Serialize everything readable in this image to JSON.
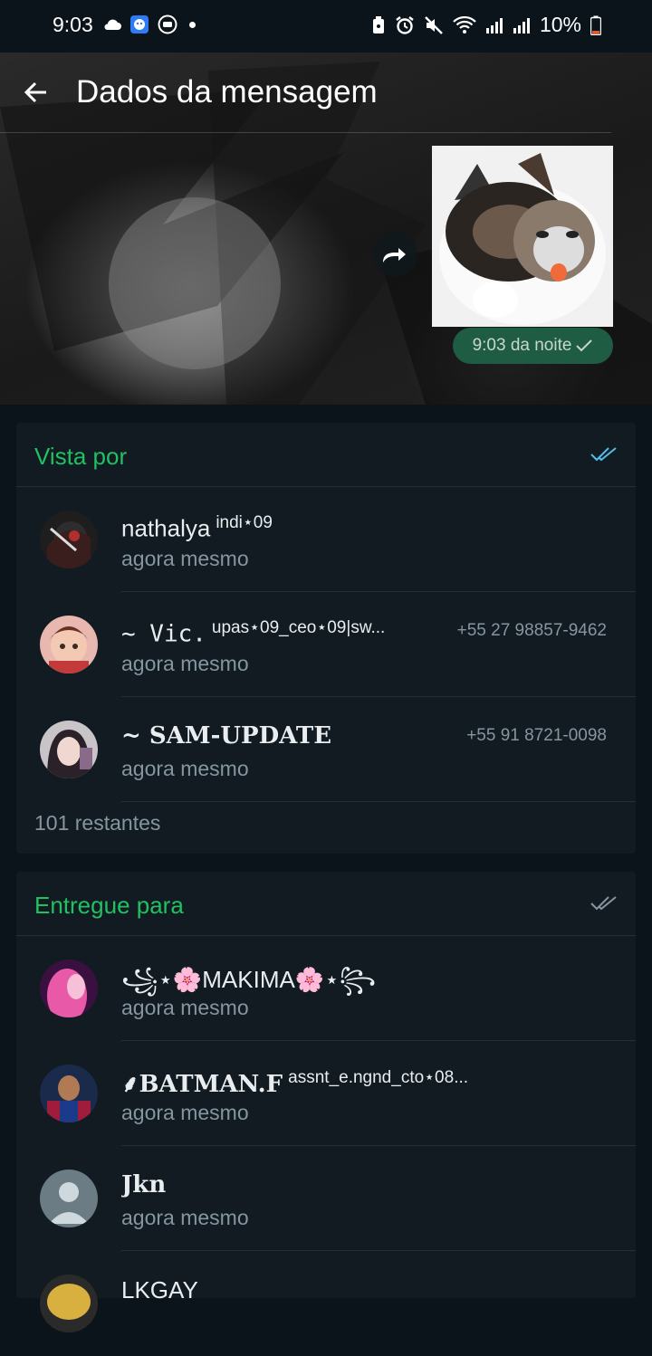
{
  "status_bar": {
    "time": "9:03",
    "battery": "10%",
    "icons": [
      "cloud-icon",
      "app-icon",
      "screen-record-icon",
      "lock-battery-icon",
      "alarm-icon",
      "mute-icon",
      "wifi-icon",
      "signal-icon",
      "signal-icon",
      "battery-icon"
    ]
  },
  "appbar": {
    "title": "Dados da mensagem",
    "back_icon": "arrow-left-icon"
  },
  "message": {
    "time": "9:03 da noite",
    "forward_icon": "forward-icon",
    "read_icon": "check-icon"
  },
  "seen": {
    "title": "Vista por",
    "items": [
      {
        "name": "nathalya",
        "subname": "indi⋆09",
        "phone": "",
        "status": "agora mesmo"
      },
      {
        "name": "~ Vic.",
        "subname": "upas⋆09_ceo⋆09|sw...",
        "phone": "+55 27 98857-9462",
        "status": "agora mesmo"
      },
      {
        "name": "~ SAM-UPDATE",
        "subname": "",
        "phone": "+55 91 8721-0098",
        "status": "agora mesmo"
      }
    ],
    "remaining": "101 restantes"
  },
  "delivered": {
    "title": "Entregue para",
    "items": [
      {
        "name": "꧁⋆🌸MAKIMA🌸⋆꧂",
        "subname": "",
        "status": "agora mesmo"
      },
      {
        "name": "⸙BATMAN.F",
        "subname": "assnt_e.ngnd_cto⋆08...",
        "status": "agora mesmo"
      },
      {
        "name": "Jkn",
        "subname": "",
        "status": "agora mesmo"
      },
      {
        "name": "LKGAY",
        "subname": "",
        "status": ""
      }
    ]
  },
  "colors": {
    "accent": "#21c063",
    "background": "#0b141a",
    "card": "#111b21",
    "muted": "#8696a0",
    "read_blue": "#53bdeb"
  }
}
